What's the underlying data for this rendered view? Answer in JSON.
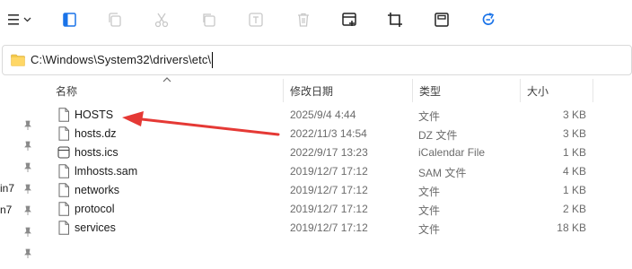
{
  "toolbar": {
    "buttons": [
      {
        "icon": "menu-icon",
        "enabled": true
      },
      {
        "icon": "preview-pane-icon",
        "enabled": true
      },
      {
        "icon": "copy-icon",
        "enabled": false
      },
      {
        "icon": "cut-icon",
        "enabled": false
      },
      {
        "icon": "paste-icon",
        "enabled": false
      },
      {
        "icon": "rename-icon",
        "enabled": false
      },
      {
        "icon": "delete-icon",
        "enabled": false
      },
      {
        "icon": "new-window-icon",
        "enabled": true
      },
      {
        "icon": "crop-icon",
        "enabled": true
      },
      {
        "icon": "save-icon",
        "enabled": true
      },
      {
        "icon": "refresh-icon",
        "enabled": true
      }
    ]
  },
  "address": {
    "path": "C:\\Windows\\System32\\drivers\\etc\\"
  },
  "columns": {
    "name": "名称",
    "modified": "修改日期",
    "type": "类型",
    "size": "大小"
  },
  "nav": {
    "items": [
      "in7",
      "n7"
    ]
  },
  "files": [
    {
      "name": "HOSTS",
      "date": "2025/9/4 4:44",
      "type": "文件",
      "size": "3 KB",
      "icon": "file-icon"
    },
    {
      "name": "hosts.dz",
      "date": "2022/11/3 14:54",
      "type": "DZ 文件",
      "size": "3 KB",
      "icon": "file-icon"
    },
    {
      "name": "hosts.ics",
      "date": "2022/9/17 13:23",
      "type": "iCalendar File",
      "size": "1 KB",
      "icon": "calendar-file-icon"
    },
    {
      "name": "lmhosts.sam",
      "date": "2019/12/7 17:12",
      "type": "SAM 文件",
      "size": "4 KB",
      "icon": "file-icon"
    },
    {
      "name": "networks",
      "date": "2019/12/7 17:12",
      "type": "文件",
      "size": "1 KB",
      "icon": "file-icon"
    },
    {
      "name": "protocol",
      "date": "2019/12/7 17:12",
      "type": "文件",
      "size": "2 KB",
      "icon": "file-icon"
    },
    {
      "name": "services",
      "date": "2019/12/7 17:12",
      "type": "文件",
      "size": "18 KB",
      "icon": "file-icon"
    }
  ],
  "colors": {
    "arrow": "#e53935",
    "accent": "#1a73e8",
    "folder": "#f2c94c"
  }
}
